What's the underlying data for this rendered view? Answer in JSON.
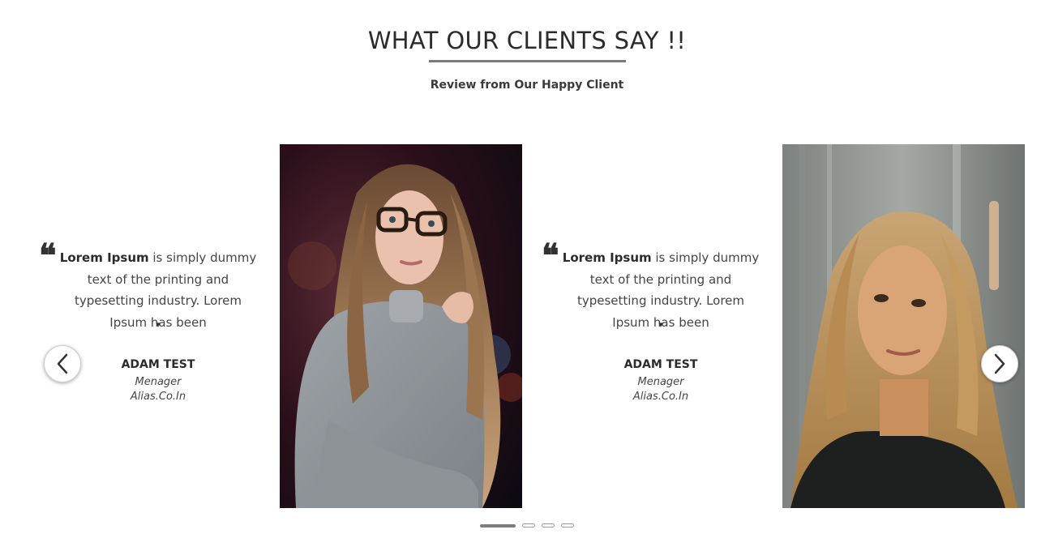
{
  "header": {
    "title": "WHAT OUR CLIENTS SAY !!",
    "subtitle": "Review from Our Happy Client"
  },
  "slides": [
    {
      "quote_bold": "Lorem Ipsum",
      "quote_rest": " is simply dummy text of the printing and typesetting industry. Lorem Ipsum has been",
      "more_icon": "▾",
      "name": "ADAM TEST",
      "role": "Menager",
      "company": "Alias.Co.In",
      "photo": "woman-with-glasses-grey-sweater"
    },
    {
      "quote_bold": "Lorem Ipsum",
      "quote_rest": " is simply dummy text of the printing and typesetting industry. Lorem Ipsum has been",
      "more_icon": "▾",
      "name": "ADAM TEST",
      "role": "Menager",
      "company": "Alias.Co.In",
      "photo": "blonde-woman-portrait"
    }
  ],
  "navigation": {
    "prev_icon": "chevron-left-icon",
    "next_icon": "chevron-right-icon"
  },
  "pagination": {
    "total": 4,
    "active_index": 0
  },
  "colors": {
    "text": "#333333",
    "underline": "#7a7a7a",
    "active_dot": "#7d7d7d"
  }
}
